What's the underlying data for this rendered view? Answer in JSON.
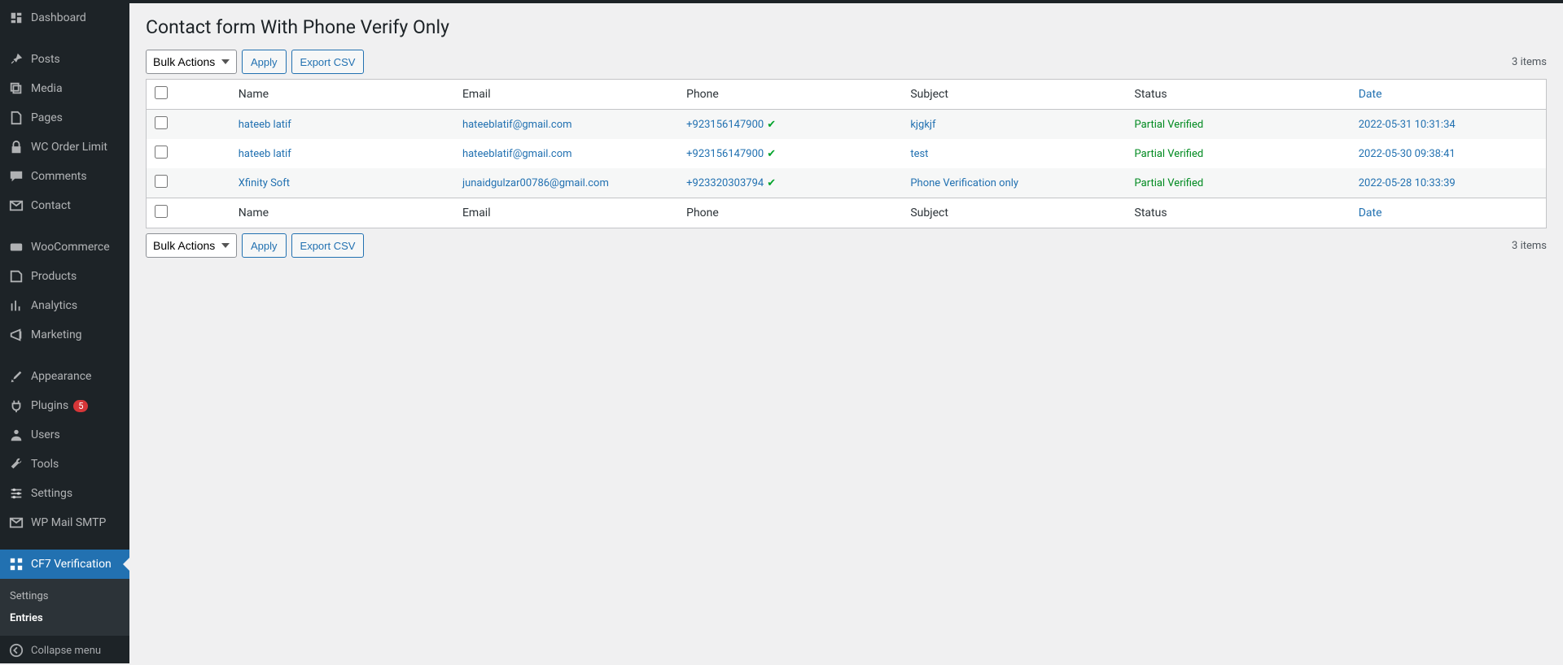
{
  "page_title": "Contact form With Phone Verify Only",
  "item_count": "3 items",
  "bulk_select": "Bulk Actions",
  "apply_btn": "Apply",
  "export_btn": "Export CSV",
  "columns": {
    "name": "Name",
    "email": "Email",
    "phone": "Phone",
    "subject": "Subject",
    "status": "Status",
    "date": "Date"
  },
  "rows": [
    {
      "name": "hateeb latif",
      "email": "hateeblatif@gmail.com",
      "phone": "+923156147900",
      "subject": "kjgkjf",
      "status": "Partial Verified",
      "date": "2022-05-31 10:31:34"
    },
    {
      "name": "hateeb latif",
      "email": "hateeblatif@gmail.com",
      "phone": "+923156147900",
      "subject": "test",
      "status": "Partial Verified",
      "date": "2022-05-30 09:38:41"
    },
    {
      "name": "Xfinity Soft",
      "email": "junaidgulzar00786@gmail.com",
      "phone": "+923320303794",
      "subject": "Phone Verification only",
      "status": "Partial Verified",
      "date": "2022-05-28 10:33:39"
    }
  ],
  "sidebar": [
    {
      "label": "Dashboard",
      "icon": "dashboard"
    },
    {
      "label": "Posts",
      "icon": "pin"
    },
    {
      "label": "Media",
      "icon": "media"
    },
    {
      "label": "Pages",
      "icon": "page"
    },
    {
      "label": "WC Order Limit",
      "icon": "lock"
    },
    {
      "label": "Comments",
      "icon": "comment"
    },
    {
      "label": "Contact",
      "icon": "mail"
    },
    {
      "label": "WooCommerce",
      "icon": "woo"
    },
    {
      "label": "Products",
      "icon": "product"
    },
    {
      "label": "Analytics",
      "icon": "bars"
    },
    {
      "label": "Marketing",
      "icon": "marketing"
    },
    {
      "label": "Appearance",
      "icon": "brush"
    },
    {
      "label": "Plugins",
      "icon": "plug",
      "badge": "5"
    },
    {
      "label": "Users",
      "icon": "user"
    },
    {
      "label": "Tools",
      "icon": "wrench"
    },
    {
      "label": "Settings",
      "icon": "sliders"
    },
    {
      "label": "WP Mail SMTP",
      "icon": "mailfly"
    },
    {
      "label": "CF7 Verification",
      "icon": "grid",
      "current": true
    }
  ],
  "submenu": [
    {
      "label": "Settings",
      "active": false
    },
    {
      "label": "Entries",
      "active": true
    }
  ],
  "collapse": "Collapse menu"
}
